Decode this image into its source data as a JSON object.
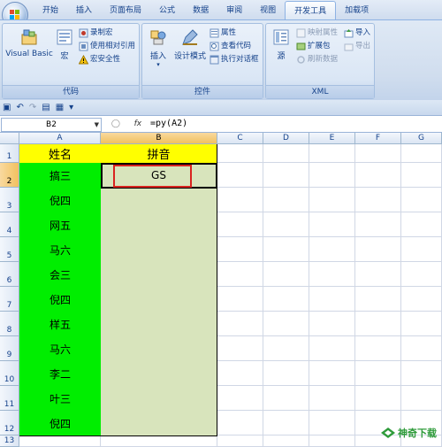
{
  "ribbon": {
    "tabs": [
      "开始",
      "插入",
      "页面布局",
      "公式",
      "数据",
      "审阅",
      "视图",
      "开发工具",
      "加载项"
    ],
    "active_tab": "开发工具",
    "groups": {
      "code": {
        "label": "代码",
        "visual_basic": "Visual Basic",
        "macros": "宏",
        "record_macro": "录制宏",
        "relative_ref": "使用相对引用",
        "macro_security": "宏安全性"
      },
      "controls": {
        "label": "控件",
        "insert": "插入",
        "design_mode": "设计模式",
        "properties": "属性",
        "view_code": "查看代码",
        "run_dialog": "执行对话框"
      },
      "xml": {
        "label": "XML",
        "source": "源",
        "map_properties": "映射属性",
        "expansion_packs": "扩展包",
        "refresh_data": "刷新数据",
        "import": "导入",
        "export": "导出"
      }
    }
  },
  "formula_bar": {
    "name_box": "B2",
    "fx": "fx",
    "formula": "=py(A2)"
  },
  "sheet": {
    "columns": [
      "A",
      "B",
      "C",
      "D",
      "E",
      "F",
      "G"
    ],
    "selected_column": "B",
    "selected_row": "2",
    "rows": [
      "1",
      "2",
      "3",
      "4",
      "5",
      "6",
      "7",
      "8",
      "9",
      "10",
      "11",
      "12",
      "13"
    ],
    "header": {
      "a": "姓名",
      "b": "拼音"
    },
    "names": [
      "搞三",
      "倪四",
      "网五",
      "马六",
      "会三",
      "倪四",
      "样五",
      "马六",
      "李二",
      "叶三",
      "倪四"
    ],
    "pinyin": [
      "GS",
      "",
      "",
      "",
      "",
      "",
      "",
      "",
      "",
      "",
      ""
    ]
  },
  "watermark": "神奇下载"
}
